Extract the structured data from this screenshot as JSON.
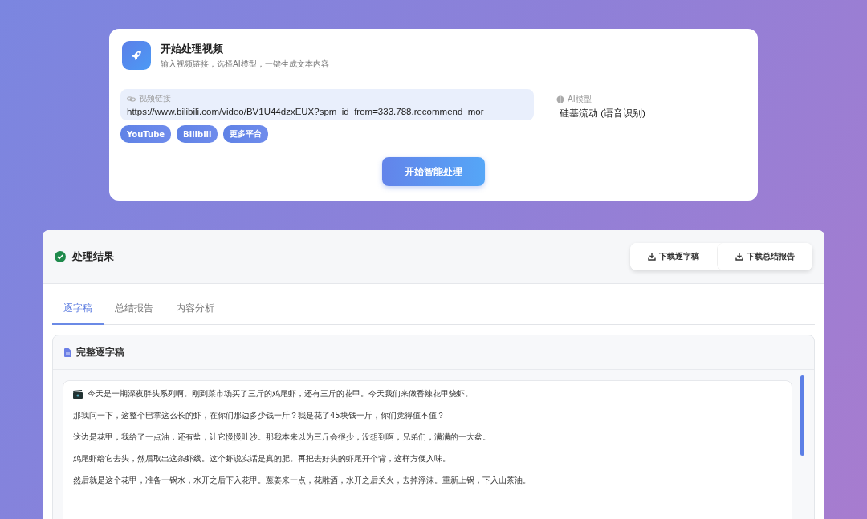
{
  "start_card": {
    "title": "开始处理视频",
    "subtitle": "输入视频链接，选择AI模型，一键生成文本内容",
    "url_field": {
      "label": "视频链接",
      "value": "https://www.bilibili.com/video/BV1U44dzxEUX?spm_id_from=333.788.recommend_mor"
    },
    "model_field": {
      "label": "AI模型",
      "value": "硅基流动 (语音识别)"
    },
    "platforms": [
      "YouTube",
      "Bilibili",
      "更多平台"
    ],
    "start_button": "开始智能处理"
  },
  "results": {
    "title": "处理结果",
    "downloads": [
      "下载逐字稿",
      "下载总结报告"
    ],
    "tabs": [
      {
        "label": "逐字稿",
        "selected": true
      },
      {
        "label": "总结报告",
        "selected": false
      },
      {
        "label": "内容分析",
        "selected": false
      }
    ],
    "transcript": {
      "title": "完整逐字稿",
      "paragraphs": [
        "今天是一期深夜胖头系列啊。刚到菜市场买了三斤的鸡尾虾，还有三斤的花甲。今天我们来做香辣花甲烧虾。",
        "那我问一下，这整个巴掌这么长的虾，在你们那边多少钱一斤？我是花了45块钱一斤，你们觉得值不值？",
        "这边是花甲，我给了一点油，还有盐，让它慢慢吐沙。那我本来以为三斤会很少，没想到啊，兄弟们，满满的一大盆。",
        "鸡尾虾给它去头，然后取出这条虾线。这个虾说实话是真的肥。再把去好头的虾尾开个背，这样方便入味。",
        "然后就是这个花甲，准备一锅水，水开之后下入花甲。葱姜来一点，花雕酒，水开之后关火，去掉浮沫。重新上锅，下入山茶油。"
      ]
    }
  }
}
